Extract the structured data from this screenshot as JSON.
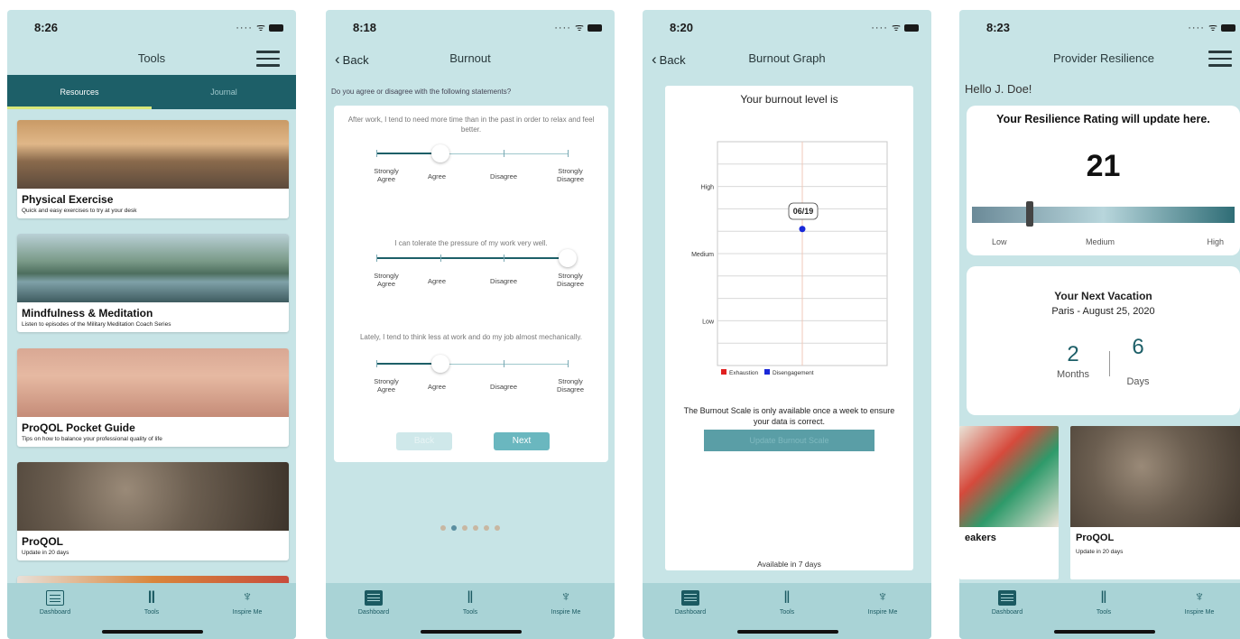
{
  "screens": {
    "tools": {
      "time": "8:26",
      "title": "Tools",
      "tabs": [
        "Resources",
        "Journal"
      ],
      "cards": [
        {
          "title": "Physical Exercise",
          "subtitle": "Quick and easy exercises to try at your desk"
        },
        {
          "title": "Mindfulness & Meditation",
          "subtitle": "Listen to episodes of the Military Meditation Coach Series"
        },
        {
          "title": "ProQOL Pocket Guide",
          "subtitle": "Tips on how to balance your professional quality of life"
        },
        {
          "title": "ProQOL",
          "subtitle": "Update in 20 days"
        }
      ]
    },
    "burnout": {
      "time": "8:18",
      "back": "Back",
      "title": "Burnout",
      "question": "Do you agree or disagree with the following statements?",
      "statements": [
        {
          "text": "After work, I tend to need more time than in the past in order to relax and feel better.",
          "selected": 1
        },
        {
          "text": "I can tolerate the pressure of my work very well.",
          "selected": 3
        },
        {
          "text": "Lately, I tend to think less at work and do my job almost mechanically.",
          "selected": 1
        }
      ],
      "scale_labels": [
        "Strongly Agree",
        "Agree",
        "Disagree",
        "Strongly Disagree"
      ],
      "back_button": "Back",
      "next_button": "Next",
      "page_count": 6,
      "current_page": 2
    },
    "graph": {
      "time": "8:20",
      "back": "Back",
      "title": "Burnout Graph",
      "heading": "Your burnout level is",
      "note": "The Burnout Scale is only available once a week to ensure your data is correct.",
      "button": "Update Burnout Scale",
      "available": "Available in 7 days",
      "chart_data": {
        "type": "scatter",
        "y_categories": [
          "Low",
          "Medium",
          "High"
        ],
        "series": [
          {
            "name": "Exhaustion",
            "color": "#e02020",
            "points": []
          },
          {
            "name": "Disengagement",
            "color": "#1a28d8",
            "points": [
              {
                "x": "06/19",
                "y": 0.61
              }
            ]
          }
        ],
        "callout": "06/19",
        "legend": "bottom"
      }
    },
    "resilience": {
      "time": "8:23",
      "title": "Provider Resilience",
      "greeting": "Hello J. Doe!",
      "rating_title": "Your Resilience Rating will update here.",
      "rating_value": "21",
      "rating_fraction": 0.22,
      "scale": [
        "Low",
        "Medium",
        "High"
      ],
      "vacation_title": "Your Next Vacation",
      "vacation_place": "Paris - August 25, 2020",
      "months_value": "2",
      "months_label": "Months",
      "days_value": "6",
      "days_label": "Days",
      "tiles": [
        {
          "title": "eakers",
          "subtitle": ""
        },
        {
          "title": "ProQOL",
          "subtitle": "Update in 20 days"
        }
      ]
    }
  },
  "tabbar": [
    "Dashboard",
    "Tools",
    "Inspire Me"
  ],
  "colors": {
    "accent": "#1d5f68",
    "background": "#c7e4e6",
    "tabbar": "#a9d3d6"
  }
}
